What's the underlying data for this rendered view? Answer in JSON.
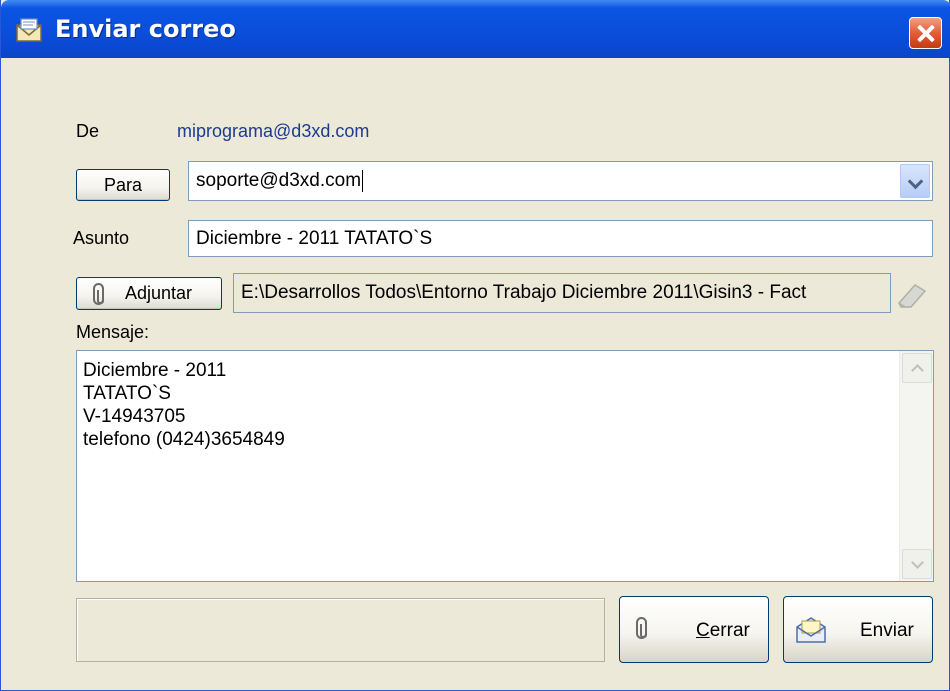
{
  "window": {
    "title": "Enviar correo"
  },
  "from": {
    "label": "De",
    "value": "miprograma@d3xd.com"
  },
  "to": {
    "button_label": "Para",
    "value": "soporte@d3xd.com"
  },
  "subject": {
    "label": "Asunto",
    "value": "Diciembre - 2011 TATATO`S"
  },
  "attach": {
    "button_label": "Adjuntar",
    "path": "E:\\Desarrollos Todos\\Entorno Trabajo Diciembre 2011\\Gisin3 - Fact"
  },
  "message": {
    "label": "Mensaje:",
    "lines": [
      "Diciembre - 2011",
      "TATATO`S",
      "V-14943705",
      "telefono (0424)3654849"
    ]
  },
  "buttons": {
    "close_accel": "C",
    "close_rest": "errar",
    "send_label": "Enviar"
  },
  "icons": [
    "mail-icon",
    "close-icon",
    "chevron-down-icon",
    "paperclip-icon",
    "eraser-icon",
    "envelope-icon"
  ]
}
